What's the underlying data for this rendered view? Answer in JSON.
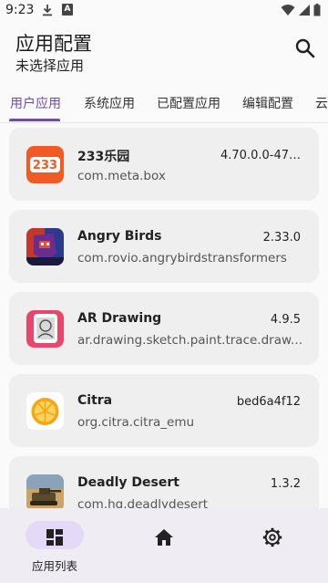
{
  "status": {
    "time": "9:23"
  },
  "header": {
    "title": "应用配置",
    "subtitle": "未选择应用"
  },
  "tabs": [
    {
      "label": "用户应用"
    },
    {
      "label": "系统应用"
    },
    {
      "label": "已配置应用"
    },
    {
      "label": "编辑配置"
    },
    {
      "label": "云"
    }
  ],
  "apps": [
    {
      "name": "233乐园",
      "package": "com.meta.box",
      "version": "4.70.0.0-47…",
      "icon": "233-icon"
    },
    {
      "name": "Angry Birds",
      "package": "com.rovio.angrybirdstransformers",
      "version": "2.33.0",
      "icon": "angry-birds-icon"
    },
    {
      "name": "AR Drawing",
      "package": "ar.drawing.sketch.paint.trace.draw.pic…",
      "version": "4.9.5",
      "icon": "ar-drawing-icon"
    },
    {
      "name": "Citra",
      "package": "org.citra.citra_emu",
      "version": "bed6a4f12",
      "icon": "citra-icon"
    },
    {
      "name": "Deadly Desert",
      "package": "com.hg.deadlydesert",
      "version": "1.3.2",
      "icon": "deadly-desert-icon"
    }
  ],
  "nav": [
    {
      "label": "应用列表",
      "icon": "grid-icon",
      "active": true
    },
    {
      "label": "",
      "icon": "home-icon"
    },
    {
      "label": "",
      "icon": "gear-icon"
    }
  ],
  "colors": {
    "accent": "#6b4fa6",
    "card": "#efefef",
    "nav_bg": "#f0ecf4",
    "nav_pill": "#e4daf7"
  }
}
